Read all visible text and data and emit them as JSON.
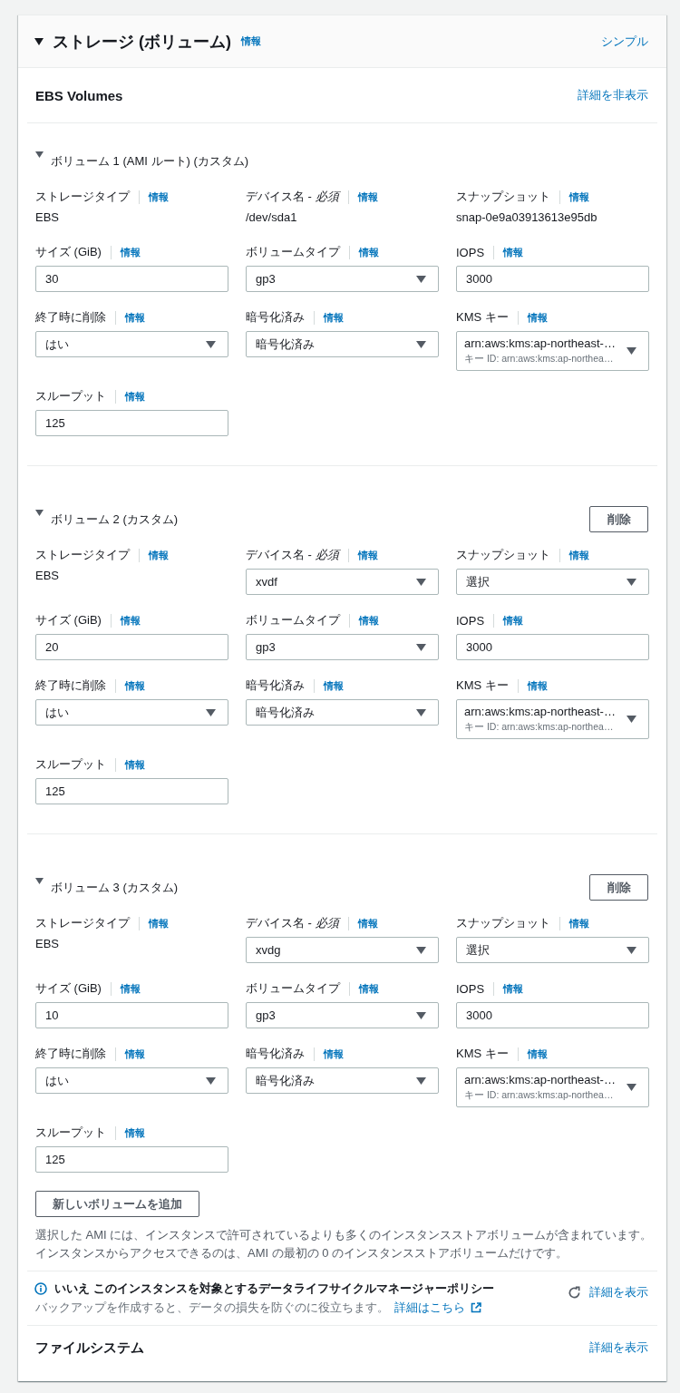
{
  "section": {
    "title": "ストレージ (ボリューム)",
    "info": "情報",
    "expanded": true,
    "mode_link": "シンプル"
  },
  "ebs_volumes": {
    "title": "EBS Volumes",
    "toggle_link": "詳細を非表示",
    "volumes": [
      {
        "title": "ボリューム 1 (AMI ルート) (カスタム)",
        "expanded": true,
        "fields": [
          {
            "label": "ストレージタイプ",
            "info": "情報",
            "kind": "text",
            "value": "EBS"
          },
          {
            "label": "デバイス名 - *必須*",
            "info": "情報",
            "kind": "text",
            "value": "/dev/sda1"
          },
          {
            "label": "スナップショット",
            "info": "情報",
            "kind": "text",
            "value": "snap-0e9a03913613e95db"
          },
          {
            "label": "サイズ (GiB)",
            "info": "情報",
            "kind": "input",
            "value": "30"
          },
          {
            "label": "ボリュームタイプ",
            "info": "情報",
            "kind": "select",
            "value": "gp3"
          },
          {
            "label": "IOPS",
            "info": "情報",
            "kind": "input",
            "value": "3000"
          },
          {
            "label": "終了時に削除",
            "info": "情報",
            "kind": "select",
            "value": "はい"
          },
          {
            "label": "暗号化済み",
            "info": "情報",
            "kind": "select",
            "value": "暗号化済み"
          },
          {
            "label": "KMS キー",
            "info": "情報",
            "kind": "select",
            "value": "arn:aws:kms:ap-northeast-…",
            "description": "キー ID: arn:aws:kms:ap-northea…"
          },
          {
            "label": "スループット",
            "info": "情報",
            "kind": "input",
            "value": "125"
          }
        ]
      },
      {
        "title": "ボリューム 2 (カスタム)",
        "expanded": true,
        "remove_button": "削除",
        "fields": [
          {
            "label": "ストレージタイプ",
            "info": "情報",
            "kind": "text",
            "value": "EBS"
          },
          {
            "label": "デバイス名 - *必須*",
            "info": "情報",
            "kind": "select",
            "value": "xvdf"
          },
          {
            "label": "スナップショット",
            "info": "情報",
            "kind": "select",
            "value": "選択"
          },
          {
            "label": "サイズ (GiB)",
            "info": "情報",
            "kind": "input",
            "value": "20"
          },
          {
            "label": "ボリュームタイプ",
            "info": "情報",
            "kind": "select",
            "value": "gp3"
          },
          {
            "label": "IOPS",
            "info": "情報",
            "kind": "input",
            "value": "3000"
          },
          {
            "label": "終了時に削除",
            "info": "情報",
            "kind": "select",
            "value": "はい"
          },
          {
            "label": "暗号化済み",
            "info": "情報",
            "kind": "select",
            "value": "暗号化済み"
          },
          {
            "label": "KMS キー",
            "info": "情報",
            "kind": "select",
            "value": "arn:aws:kms:ap-northeast-…",
            "description": "キー ID: arn:aws:kms:ap-northea…"
          },
          {
            "label": "スループット",
            "info": "情報",
            "kind": "input",
            "value": "125"
          }
        ]
      },
      {
        "title": "ボリューム 3 (カスタム)",
        "expanded": true,
        "remove_button": "削除",
        "fields": [
          {
            "label": "ストレージタイプ",
            "info": "情報",
            "kind": "text",
            "value": "EBS"
          },
          {
            "label": "デバイス名 - *必須*",
            "info": "情報",
            "kind": "select",
            "value": "xvdg"
          },
          {
            "label": "スナップショット",
            "info": "情報",
            "kind": "select",
            "value": "選択"
          },
          {
            "label": "サイズ (GiB)",
            "info": "情報",
            "kind": "input",
            "value": "10"
          },
          {
            "label": "ボリュームタイプ",
            "info": "情報",
            "kind": "select",
            "value": "gp3"
          },
          {
            "label": "IOPS",
            "info": "情報",
            "kind": "input",
            "value": "3000"
          },
          {
            "label": "終了時に削除",
            "info": "情報",
            "kind": "select",
            "value": "はい"
          },
          {
            "label": "暗号化済み",
            "info": "情報",
            "kind": "select",
            "value": "暗号化済み"
          },
          {
            "label": "KMS キー",
            "info": "情報",
            "kind": "select",
            "value": "arn:aws:kms:ap-northeast-…",
            "description": "キー ID: arn:aws:kms:ap-northea…"
          },
          {
            "label": "スループット",
            "info": "情報",
            "kind": "input",
            "value": "125"
          }
        ]
      }
    ],
    "add_button": "新しいボリュームを追加",
    "notes": [
      "選択した AMI には、インスタンスで許可されているよりも多くのインスタンスストアボリュームが含まれています。",
      "インスタンスからアクセスできるのは、AMI の最初の 0 のインスタンスストアボリュームだけです。"
    ]
  },
  "lifecycle_policy": {
    "title": "いいえ このインスタンスを対象とするデータライフサイクルマネージャーポリシー",
    "description": "バックアップを作成すると、データの損失を防ぐのに役立ちます。",
    "learn_more_link": "詳細はこちら",
    "details_link": "詳細を表示"
  },
  "file_systems": {
    "title": "ファイルシステム",
    "details_link": "詳細を表示"
  }
}
